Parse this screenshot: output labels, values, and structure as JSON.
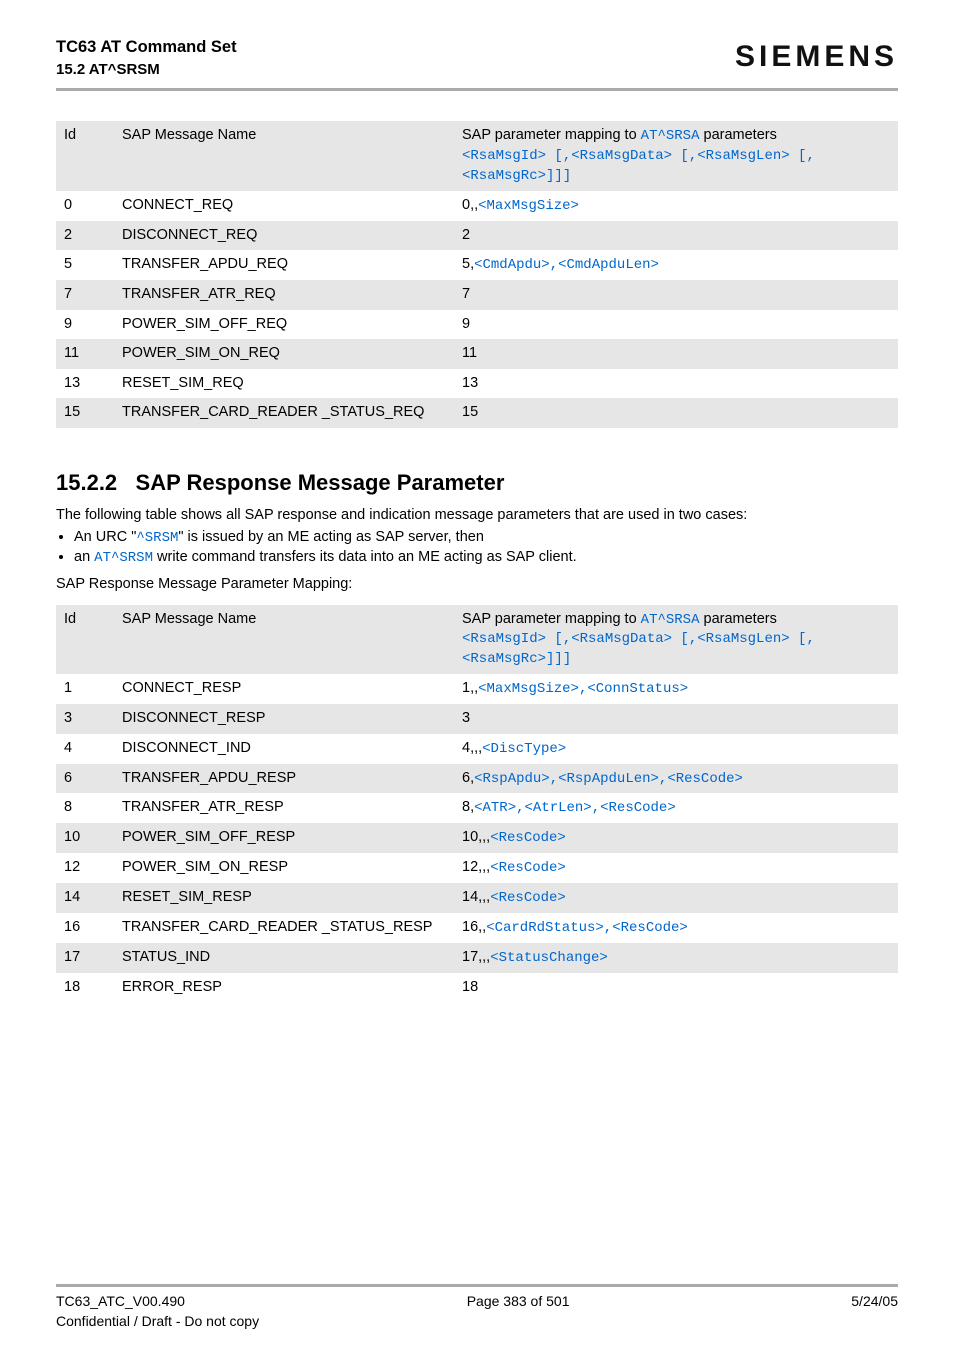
{
  "header": {
    "title": "TC63 AT Command Set",
    "subtitle": "15.2 AT^SRSM",
    "brand": "SIEMENS"
  },
  "table1": {
    "head": {
      "id": "Id",
      "name": "SAP Message Name",
      "map_pre": "SAP parameter mapping to ",
      "map_cmd": "AT^SRSA",
      "map_post": " parameters",
      "sig": "<RsaMsgId> [,<RsaMsgData> [,<RsaMsgLen> [,<RsaMsgRc>]]]"
    },
    "rows": [
      {
        "id": "0",
        "name": "CONNECT_REQ",
        "map_plain": "0,,",
        "map_mono": "<MaxMsgSize>"
      },
      {
        "id": "2",
        "name": "DISCONNECT_REQ",
        "map_plain": "2",
        "map_mono": ""
      },
      {
        "id": "5",
        "name": "TRANSFER_APDU_REQ",
        "map_plain": "5,",
        "map_mono": "<CmdApdu>,<CmdApduLen>"
      },
      {
        "id": "7",
        "name": "TRANSFER_ATR_REQ",
        "map_plain": "7",
        "map_mono": ""
      },
      {
        "id": "9",
        "name": "POWER_SIM_OFF_REQ",
        "map_plain": "9",
        "map_mono": ""
      },
      {
        "id": "11",
        "name": "POWER_SIM_ON_REQ",
        "map_plain": "11",
        "map_mono": ""
      },
      {
        "id": "13",
        "name": "RESET_SIM_REQ",
        "map_plain": "13",
        "map_mono": ""
      },
      {
        "id": "15",
        "name": "TRANSFER_CARD_READER _STATUS_REQ",
        "map_plain": "15",
        "map_mono": ""
      }
    ]
  },
  "section": {
    "number": "15.2.2",
    "title": "SAP Response Message Parameter",
    "intro": "The following table shows all SAP response and indication message parameters that are used in two cases:",
    "b1_pre": "An URC \"",
    "b1_code": "^SRSM",
    "b1_post": "\" is issued by an ME acting as SAP server, then",
    "b2_pre": "an ",
    "b2_code": "AT^SRSM",
    "b2_post": " write command transfers its data into an ME acting as SAP client.",
    "after": "SAP Response Message Parameter Mapping:"
  },
  "table2": {
    "head": {
      "id": "Id",
      "name": "SAP Message Name",
      "map_pre": "SAP parameter mapping to ",
      "map_cmd": "AT^SRSA",
      "map_post": " parameters",
      "sig": "<RsaMsgId> [,<RsaMsgData> [,<RsaMsgLen> [,<RsaMsgRc>]]]"
    },
    "rows": [
      {
        "id": "1",
        "name": "CONNECT_RESP",
        "map_plain": "1,,",
        "map_mono": "<MaxMsgSize>,<ConnStatus>"
      },
      {
        "id": "3",
        "name": "DISCONNECT_RESP",
        "map_plain": "3",
        "map_mono": ""
      },
      {
        "id": "4",
        "name": "DISCONNECT_IND",
        "map_plain": "4,,,",
        "map_mono": "<DiscType>"
      },
      {
        "id": "6",
        "name": "TRANSFER_APDU_RESP",
        "map_plain": "6,",
        "map_mono": "<RspApdu>,<RspApduLen>,<ResCode>"
      },
      {
        "id": "8",
        "name": "TRANSFER_ATR_RESP",
        "map_plain": "8,",
        "map_mono": "<ATR>,<AtrLen>,<ResCode>"
      },
      {
        "id": "10",
        "name": "POWER_SIM_OFF_RESP",
        "map_plain": "10,,,",
        "map_mono": "<ResCode>"
      },
      {
        "id": "12",
        "name": "POWER_SIM_ON_RESP",
        "map_plain": "12,,,",
        "map_mono": "<ResCode>"
      },
      {
        "id": "14",
        "name": "RESET_SIM_RESP",
        "map_plain": "14,,,",
        "map_mono": "<ResCode>"
      },
      {
        "id": "16",
        "name": "TRANSFER_CARD_READER _STATUS_RESP",
        "map_plain": "16,,",
        "map_mono": "<CardRdStatus>,<ResCode>"
      },
      {
        "id": "17",
        "name": "STATUS_IND",
        "map_plain": "17,,,",
        "map_mono": "<StatusChange>"
      },
      {
        "id": "18",
        "name": "ERROR_RESP",
        "map_plain": "18",
        "map_mono": ""
      }
    ]
  },
  "footer": {
    "left": "TC63_ATC_V00.490",
    "center": "Page 383 of 501",
    "right": "5/24/05",
    "note": "Confidential / Draft - Do not copy"
  }
}
